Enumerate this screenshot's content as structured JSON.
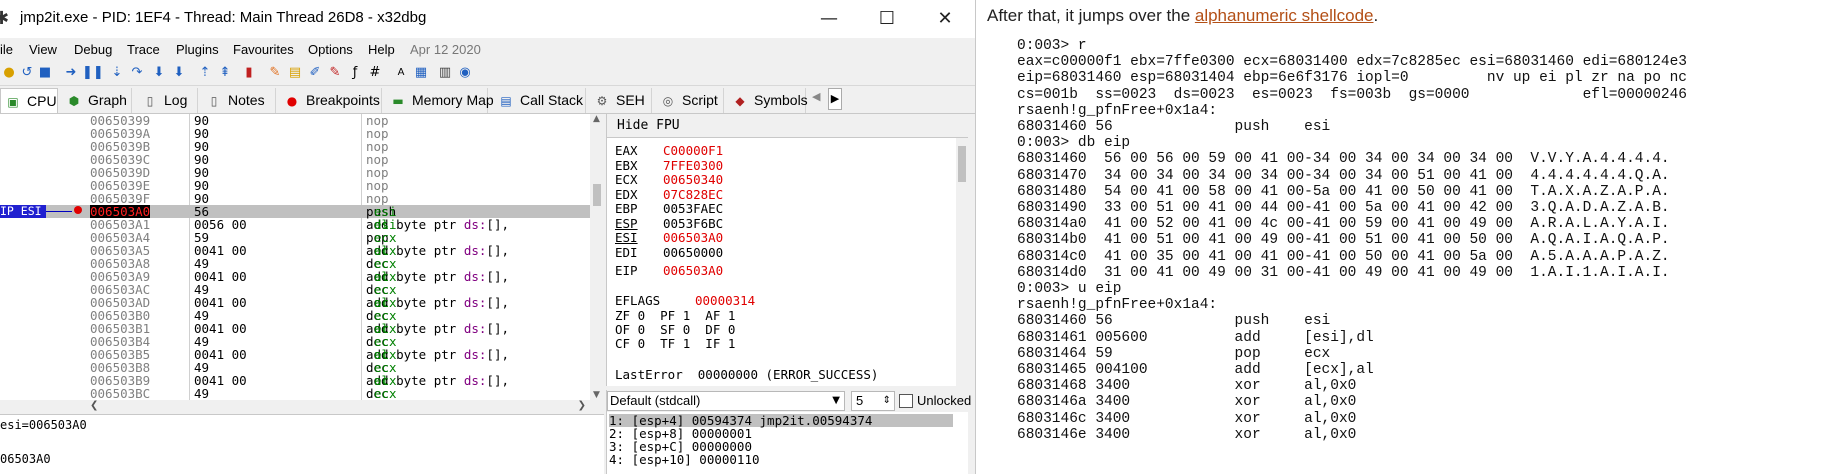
{
  "window": {
    "title": "jmp2it.exe - PID: 1EF4 - Thread: Main Thread 26D8 - x32dbg",
    "minimize": "—",
    "maximize": "☐",
    "close": "✕"
  },
  "menu": [
    "ile",
    "View",
    "Debug",
    "Trace",
    "Plugins",
    "Favourites",
    "Options",
    "Help",
    "Apr 12 2020"
  ],
  "toolbar_icons": [
    "open-icon",
    "restart-icon",
    "stop-icon",
    "run-icon",
    "pause-icon",
    "step-into-icon",
    "step-over-icon",
    "trace-into-icon",
    "trace-over-icon",
    "execute-till-return-icon",
    "run-to-user-code-icon",
    "script-icon",
    "patch-icon",
    "comments-icon",
    "labels-icon",
    "bookmarks-icon",
    "functions-icon",
    "hash-icon",
    "strings-icon",
    "calculator-icon",
    "notes-icon",
    "help-icon"
  ],
  "tabs": [
    {
      "label": "CPU",
      "icon": "cpu-icon"
    },
    {
      "label": "Graph",
      "icon": "graph-icon"
    },
    {
      "label": "Log",
      "icon": "log-icon"
    },
    {
      "label": "Notes",
      "icon": "notes-icon"
    },
    {
      "label": "Breakpoints",
      "icon": "breakpoint-icon"
    },
    {
      "label": "Memory Map",
      "icon": "memory-icon"
    },
    {
      "label": "Call Stack",
      "icon": "callstack-icon"
    },
    {
      "label": "SEH",
      "icon": "seh-icon"
    },
    {
      "label": "Script",
      "icon": "script-icon"
    },
    {
      "label": "Symbols",
      "icon": "symbols-icon"
    }
  ],
  "eip_label": "IP ESI",
  "disasm": [
    {
      "addr": "00650399",
      "bytes": "90",
      "ins": "nop"
    },
    {
      "addr": "0065039A",
      "bytes": "90",
      "ins": "nop"
    },
    {
      "addr": "0065039B",
      "bytes": "90",
      "ins": "nop"
    },
    {
      "addr": "0065039C",
      "bytes": "90",
      "ins": "nop"
    },
    {
      "addr": "0065039D",
      "bytes": "90",
      "ins": "nop"
    },
    {
      "addr": "0065039E",
      "bytes": "90",
      "ins": "nop"
    },
    {
      "addr": "0065039F",
      "bytes": "90",
      "ins": "nop"
    },
    {
      "addr": "006503A0",
      "bytes": "56",
      "ins": "push esi"
    },
    {
      "addr": "006503A1",
      "bytes": "0056 00",
      "ins": "add byte ptr ds:[esi],dl"
    },
    {
      "addr": "006503A4",
      "bytes": "59",
      "ins": "pop ecx"
    },
    {
      "addr": "006503A5",
      "bytes": "0041 00",
      "ins": "add byte ptr ds:[ecx],al"
    },
    {
      "addr": "006503A8",
      "bytes": "49",
      "ins": "dec ecx"
    },
    {
      "addr": "006503A9",
      "bytes": "0041 00",
      "ins": "add byte ptr ds:[ecx],al"
    },
    {
      "addr": "006503AC",
      "bytes": "49",
      "ins": "dec ecx"
    },
    {
      "addr": "006503AD",
      "bytes": "0041 00",
      "ins": "add byte ptr ds:[ecx],al"
    },
    {
      "addr": "006503B0",
      "bytes": "49",
      "ins": "dec ecx"
    },
    {
      "addr": "006503B1",
      "bytes": "0041 00",
      "ins": "add byte ptr ds:[ecx],al"
    },
    {
      "addr": "006503B4",
      "bytes": "49",
      "ins": "dec ecx"
    },
    {
      "addr": "006503B5",
      "bytes": "0041 00",
      "ins": "add byte ptr ds:[ecx],al"
    },
    {
      "addr": "006503B8",
      "bytes": "49",
      "ins": "dec ecx"
    },
    {
      "addr": "006503B9",
      "bytes": "0041 00",
      "ins": "add byte ptr ds:[ecx],al"
    },
    {
      "addr": "006503BC",
      "bytes": "49",
      "ins": "dec ecx"
    }
  ],
  "selected_row": 7,
  "info_lines": [
    "esi=006503A0",
    "",
    "06503A0"
  ],
  "registers": {
    "header": "Hide FPU",
    "gp": [
      {
        "name": "EAX",
        "value": "C00000F1",
        "changed": true
      },
      {
        "name": "EBX",
        "value": "7FFE0300",
        "changed": true
      },
      {
        "name": "ECX",
        "value": "00650340",
        "changed": true
      },
      {
        "name": "EDX",
        "value": "07C828EC",
        "changed": true
      },
      {
        "name": "EBP",
        "value": "0053FAEC",
        "changed": false
      },
      {
        "name": "ESP",
        "value": "0053F6BC",
        "changed": false
      },
      {
        "name": "ESI",
        "value": "006503A0",
        "changed": true
      },
      {
        "name": "EDI",
        "value": "00650000",
        "changed": false
      }
    ],
    "eip": {
      "name": "EIP",
      "value": "006503A0"
    },
    "eflags": {
      "name": "EFLAGS",
      "value": "00000314"
    },
    "flags": [
      "ZF 0  PF 1  AF 1",
      "OF 0  SF 0  DF 0",
      "CF 0  TF 1  IF 1"
    ],
    "lasterror": "LastError  00000000 (ERROR_SUCCESS)"
  },
  "callconv": {
    "selected": "Default (stdcall)",
    "count": "5",
    "unlocked_label": "Unlocked"
  },
  "stack_args": [
    "1: [esp+4] 00594374 jmp2it.00594374",
    "2: [esp+8] 00000001",
    "3: [esp+C] 00000000",
    "4: [esp+10] 00000110"
  ],
  "article": {
    "text_before": "After that, it jumps over the ",
    "link": "alphanumeric shellcode",
    "text_after": ".",
    "code_lines": [
      "0:003> r",
      "eax=c00000f1 ebx=7ffe0300 ecx=68031400 edx=7c8285ec esi=68031460 edi=680124e3",
      "eip=68031460 esp=68031404 ebp=6e6f3176 iopl=0         nv up ei pl zr na po nc",
      "cs=001b  ss=0023  ds=0023  es=0023  fs=003b  gs=0000             efl=00000246",
      "rsaenh!g_pfnFree+0x1a4:",
      "68031460 56              push    esi",
      "0:003> db eip",
      "68031460  56 00 56 00 59 00 41 00-34 00 34 00 34 00 34 00  V.V.Y.A.4.4.4.4.",
      "68031470  34 00 34 00 34 00 34 00-34 00 34 00 51 00 41 00  4.4.4.4.4.4.Q.A.",
      "68031480  54 00 41 00 58 00 41 00-5a 00 41 00 50 00 41 00  T.A.X.A.Z.A.P.A.",
      "68031490  33 00 51 00 41 00 44 00-41 00 5a 00 41 00 42 00  3.Q.A.D.A.Z.A.B.",
      "680314a0  41 00 52 00 41 00 4c 00-41 00 59 00 41 00 49 00  A.R.A.L.A.Y.A.I.",
      "680314b0  41 00 51 00 41 00 49 00-41 00 51 00 41 00 50 00  A.Q.A.I.A.Q.A.P.",
      "680314c0  41 00 35 00 41 00 41 00-41 00 50 00 41 00 5a 00  A.5.A.A.A.P.A.Z.",
      "680314d0  31 00 41 00 49 00 31 00-41 00 49 00 41 00 49 00  1.A.I.1.A.I.A.I.",
      "0:003> u eip",
      "rsaenh!g_pfnFree+0x1a4:",
      "68031460 56              push    esi",
      "68031461 005600          add     [esi],dl",
      "68031464 59              pop     ecx",
      "68031465 004100          add     [ecx],al",
      "68031468 3400            xor     al,0x0",
      "6803146a 3400            xor     al,0x0",
      "6803146c 3400            xor     al,0x0",
      "6803146e 3400            xor     al,0x0"
    ]
  }
}
